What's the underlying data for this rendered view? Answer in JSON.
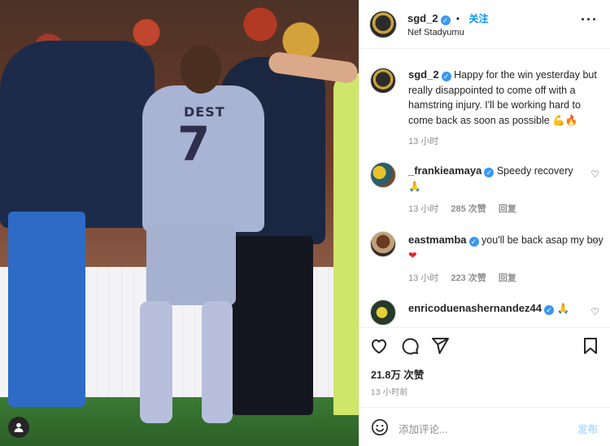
{
  "post": {
    "username": "sgd_2",
    "follow_label": "关注",
    "dot": "•",
    "location": "Nef Stadyumu",
    "more_icon": "more-horizontal-icon"
  },
  "photo": {
    "jersey_name": "DEST",
    "jersey_number": "7"
  },
  "caption": {
    "username": "sgd_2",
    "text": "Happy for the win yesterday but really disappointed to come off with a hamstring injury. I'll be working hard to come back as soon as possible",
    "emoji": "💪🔥",
    "time": "13 小时"
  },
  "comments": [
    {
      "username": "_frankieamaya",
      "text": "Speedy recovery",
      "emoji": "🙏",
      "time": "13 小时",
      "likes": "285 次赞",
      "reply": "回复"
    },
    {
      "username": "eastmamba",
      "text": "you'll be back asap my boy",
      "emoji": "❤",
      "time": "13 小时",
      "likes": "223 次赞",
      "reply": "回复"
    },
    {
      "username": "enricoduenashernandez44",
      "text": "",
      "emoji": "🙏",
      "time": "",
      "likes": "",
      "reply": ""
    }
  ],
  "actions": {
    "like_icon": "heart-icon",
    "comment_icon": "comment-icon",
    "share_icon": "send-icon",
    "save_icon": "bookmark-icon"
  },
  "likes_count": "21.8万 次赞",
  "post_time": "13 小时前",
  "add_comment": {
    "placeholder": "添加评论...",
    "post_label": "发布"
  },
  "colors": {
    "accent": "#0095f6",
    "verified": "#3897f0",
    "muted": "#8e8e8e",
    "post_disabled": "#b3dbff"
  }
}
